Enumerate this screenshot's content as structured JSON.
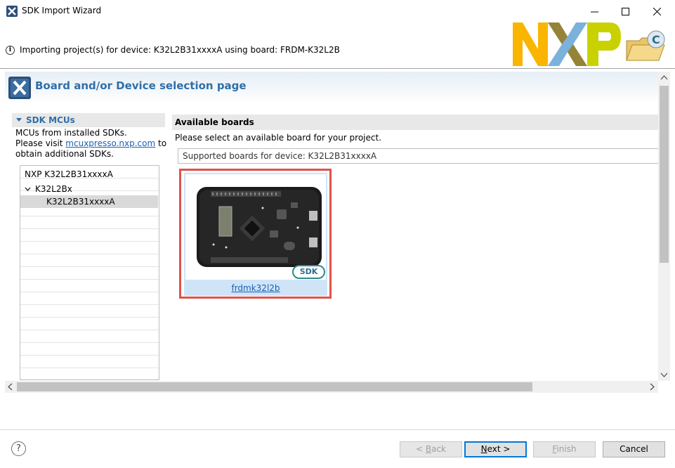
{
  "window": {
    "title": "SDK Import Wizard"
  },
  "banner": {
    "info_text": "Importing project(s) for device: K32L2B31xxxxA using board: FRDM-K32L2B"
  },
  "page": {
    "title": "Board and/or Device selection page"
  },
  "sdk_panel": {
    "header": "SDK MCUs",
    "line1": "MCUs from installed SDKs.",
    "line2_prefix": "Please visit ",
    "link": "mcuxpresso.nxp.com",
    "line2_suffix": " to",
    "line3": "obtain additional SDKs.",
    "tree": [
      {
        "label": "NXP K32L2B31xxxxA"
      },
      {
        "label": "K32L2Bx"
      },
      {
        "label": "K32L2B31xxxxA"
      }
    ]
  },
  "boards_panel": {
    "header": "Available boards",
    "subtitle": "Please select an available board for your project.",
    "filter": "Supported boards for device: K32L2B31xxxxA",
    "board_name": "frdmk32l2b",
    "badge": "SDK"
  },
  "buttons": {
    "back": {
      "mnemonic": "B",
      "rest": "ack",
      "prefix": "< "
    },
    "next": {
      "mnemonic": "N",
      "rest": "ext",
      "suffix": " >"
    },
    "finish": {
      "mnemonic": "F",
      "rest": "inish"
    },
    "cancel": "Cancel"
  },
  "icons": {
    "app": "sdk-wizard-icon",
    "info": "info-icon",
    "help": "help-icon"
  },
  "colors": {
    "accent": "#2f6fa8",
    "selection_border": "#e0524a",
    "link": "#1a5fb4"
  }
}
